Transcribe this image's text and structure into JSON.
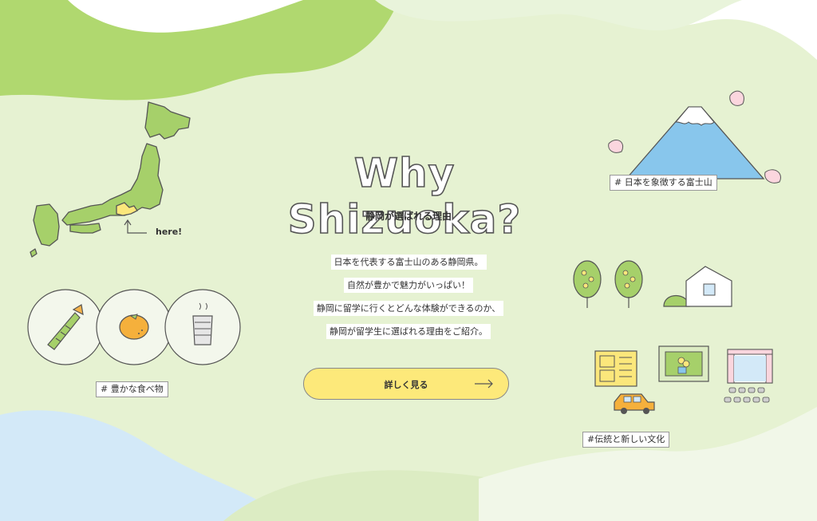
{
  "hero": {
    "title": "Why Shizuoka?",
    "subtitle": "静岡が選ばれる理由",
    "description": [
      "日本を代表する富士山のある静岡県。",
      "自然が豊かで魅力がいっぱい！",
      "静岡に留学に行くとどんな体験ができるのか、",
      "静岡が留学生に選ばれる理由をご紹介。"
    ],
    "cta_label": "詳しく見る"
  },
  "map": {
    "marker_label": "here!"
  },
  "tags": {
    "food": "# 豊かな食べ物",
    "fuji": "# 日本を象徴する富士山",
    "culture": "#伝統と新しい文化"
  },
  "colors": {
    "background": "#e6f2d2",
    "wave_green": "#b0d86f",
    "wave_blue": "#d3e9f8",
    "button_yellow": "#fde97a",
    "map_green": "#a6d06a",
    "shizuoka_yellow": "#fbe77b",
    "fuji_blue": "#88c6ec",
    "sakura_pink": "#fbd6de"
  }
}
